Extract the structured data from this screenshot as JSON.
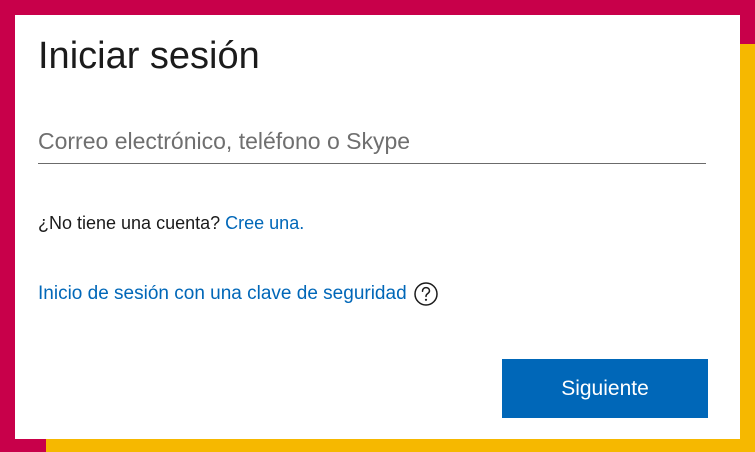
{
  "colors": {
    "background_primary": "#c8004a",
    "background_secondary": "#f6b800",
    "card": "#ffffff",
    "link": "#0067b8",
    "button": "#0067b8",
    "button_text": "#ffffff"
  },
  "signin": {
    "title": "Iniciar sesión",
    "email_placeholder": "Correo electrónico, teléfono o Skype",
    "email_value": "",
    "no_account_text": "¿No tiene una cuenta?",
    "create_account_link": "Cree una.",
    "security_key_link": "Inicio de sesión con una clave de seguridad",
    "help_icon": "question-circle-icon",
    "next_button": "Siguiente"
  }
}
